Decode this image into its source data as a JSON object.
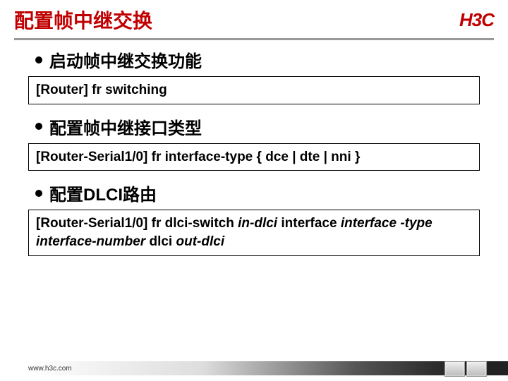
{
  "header": {
    "title": "配置帧中继交换",
    "logo": "H3C"
  },
  "sections": {
    "s1": {
      "bullet": "启动帧中继交换功能",
      "cmd": "[Router] fr switching"
    },
    "s2": {
      "bullet": "配置帧中继接口类型",
      "cmd": "[Router-Serial1/0] fr interface-type { dce | dte | nni }"
    },
    "s3": {
      "bullet": "配置DLCI路由",
      "cmd_pre": "[Router-Serial1/0] fr dlci-switch ",
      "cmd_i1": "in-dlci",
      "cmd_mid1": " interface ",
      "cmd_i2": "interface -type interface-number",
      "cmd_mid2": " dlci ",
      "cmd_i3": "out-dlci"
    }
  },
  "footer": {
    "url": "www.h3c.com"
  }
}
